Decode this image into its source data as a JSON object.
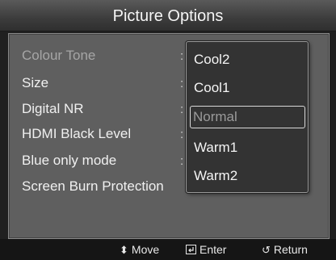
{
  "header": {
    "title": "Picture Options"
  },
  "menu": {
    "items": [
      {
        "label": "Colour Tone",
        "value_separator": ":"
      },
      {
        "label": "Size",
        "value_separator": ":"
      },
      {
        "label": "Digital NR",
        "value_separator": ":"
      },
      {
        "label": "HDMI Black Level",
        "value_separator": ":"
      },
      {
        "label": "Blue only mode",
        "value_separator": ":"
      },
      {
        "label": "Screen Burn Protection"
      }
    ]
  },
  "dropdown": {
    "options": [
      "Cool2",
      "Cool1",
      "Normal",
      "Warm1",
      "Warm2"
    ],
    "selected": "Normal"
  },
  "footer": {
    "move": {
      "icon": "updown-arrow-icon",
      "label": "Move"
    },
    "enter": {
      "icon": "enter-icon",
      "label": "Enter"
    },
    "return": {
      "icon": "return-icon",
      "label": "Return"
    }
  }
}
